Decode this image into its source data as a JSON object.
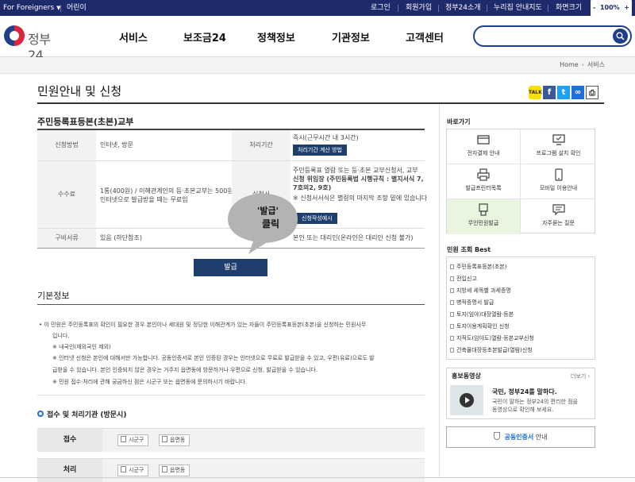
{
  "topbar": {
    "foreigners": "For Foreigners",
    "kids": "어린이",
    "login": "로그인",
    "join": "회원가입",
    "about": "정부24소개",
    "sitemap": "누리집 안내지도",
    "screen_size": "화면크기",
    "zoom": "100%",
    "zoom_minus": "-",
    "zoom_plus": "+"
  },
  "header": {
    "logo": "정부24",
    "nav": [
      "서비스",
      "보조금24",
      "정책정보",
      "기관정보",
      "고객센터"
    ],
    "search_placeholder": ""
  },
  "breadcrumb": {
    "home": "Home",
    "current": "서비스"
  },
  "page": {
    "title": "민원안내 및 신청"
  },
  "share": {
    "kakao": "카카오",
    "facebook": "f",
    "twitter": "t",
    "link": "∞",
    "print": "⎙"
  },
  "service": {
    "title": "주민등록표등본(초본)교부",
    "method_label": "신청방법",
    "method_value": "인터넷, 방문",
    "period_label": "처리기간",
    "period_value": "즉시(근무시간 내 3시간)",
    "period_button": "처리기간 계산 방법",
    "fee_label": "수수료",
    "fee_value_1": "1통(400원) / 이해관계인의 등·초본교부는 500원 /",
    "fee_value_2": "인터넷으로 발급받을 때는 무료임",
    "form_label": "신청서",
    "form_value_1": "주민등록표 열람 또는 등·초본 교부신청서, 교부",
    "form_value_2": "신청 위임장 (주민등록법 시행규칙 : 별지서식 7,",
    "form_value_3": "7호의2, 9호)",
    "form_value_4": "※ 신청서서식은 별령의 마지막 조항 밑에 있습니다",
    "form_button": "신청작성예시",
    "docs_label": "구비서류",
    "docs_value": "있음 (하단참조)",
    "docs_value_right": "본인 또는 대리인(온라인은 대리인 신청 불가)",
    "issue_button": "발급"
  },
  "callout": {
    "line1": "'발급'",
    "line2": "클릭"
  },
  "basic": {
    "title": "기본정보",
    "lines": [
      "• 이 민원은 주민등록표의 확인이 필요한 경우 본인이나 세대원 및 정당한 이해관계가 있는 자들이 주민등록표등본(초본)을 신청하는 민원사무",
      "입니다.",
      "※ 내국인(재외국인 제외)",
      "※ 인터넷 신청은 본인에 대해서만 가능합니다. 공동인증서로 본인 인증된 경우는 인터넷으로 무료로 발급받을 수 있고, 우편(유료)으로도 발",
      "급받을 수 있습니다. 본인 인증되지 않은 경우는 거주지 읍면동에 방문하거나 우편으로 신청, 발급받을 수 있습니다.",
      "※ 민원 접수·처리에 관해 궁금하신 점은 시군구 또는 읍면동에 문의하시기 바랍니다."
    ]
  },
  "process": {
    "title": "접수 및 처리기관 (방문시)",
    "rows": [
      {
        "label": "접수",
        "chips": [
          "시군구",
          "읍면동"
        ]
      },
      {
        "label": "처리",
        "chips": [
          "시군구",
          "읍면동"
        ]
      }
    ]
  },
  "quick": {
    "title": "바로가기",
    "items": [
      {
        "label": "전자결제 안내",
        "icon": "payment-icon"
      },
      {
        "label": "프로그램 설치 확인",
        "icon": "monitor-check-icon"
      },
      {
        "label": "발급프린터목록",
        "icon": "printer-icon"
      },
      {
        "label": "모바일 이용안내",
        "icon": "mobile-icon"
      },
      {
        "label": "무인민원발급",
        "icon": "kiosk-icon"
      },
      {
        "label": "자주묻는 질문",
        "icon": "faq-icon"
      }
    ],
    "highlight_color": "#e9f5df"
  },
  "best": {
    "title": "민원 조회 Best",
    "items": [
      "주민등록표등본(초본)",
      "전입신고",
      "지방세 세목별 과세증명",
      "병적증명서 발급",
      "토지(임야)대장열람·등본",
      "토지이용계획확인 신청",
      "지적도(임야도)열람·등본교부신청",
      "건축물대장등초본발급(열람)신청"
    ]
  },
  "video": {
    "title": "홍보동영상",
    "more": "더보기 ›",
    "headline": "국민, 정부24를 말하다.",
    "desc1": "국민이 말하는 정부24의 편리한 점을",
    "desc2": "동영상으로 확인해 보세요."
  },
  "cert": {
    "highlight": "공동인증서",
    "rest": " 안내"
  },
  "colors": {
    "navy": "#1e2a6b",
    "button": "#1e3f6e",
    "accent": "#1e6fd9"
  }
}
